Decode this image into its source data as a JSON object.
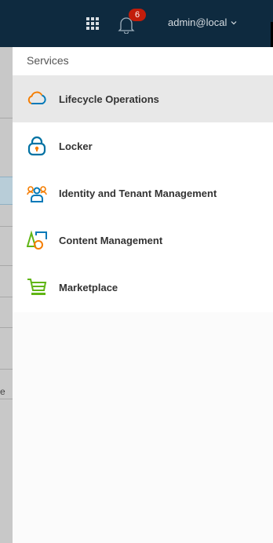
{
  "topbar": {
    "notification_count": "6",
    "user_label": "admin@local"
  },
  "left_strip": {
    "fragment": "e"
  },
  "services": {
    "header": "Services",
    "items": [
      {
        "label": "Lifecycle Operations",
        "icon": "cloud-icon",
        "active": true
      },
      {
        "label": "Locker",
        "icon": "lock-icon",
        "active": false
      },
      {
        "label": "Identity and Tenant Management",
        "icon": "users-icon",
        "active": false
      },
      {
        "label": "Content Management",
        "icon": "shapes-icon",
        "active": false
      },
      {
        "label": "Marketplace",
        "icon": "cart-icon",
        "active": false
      }
    ]
  },
  "colors": {
    "topbar_bg": "#0e2a3f",
    "badge": "#c21d0b",
    "cloud_orange": "#f57d00",
    "cloud_blue": "#0079b8",
    "lock_blue": "#0072a3",
    "green": "#60b515"
  }
}
